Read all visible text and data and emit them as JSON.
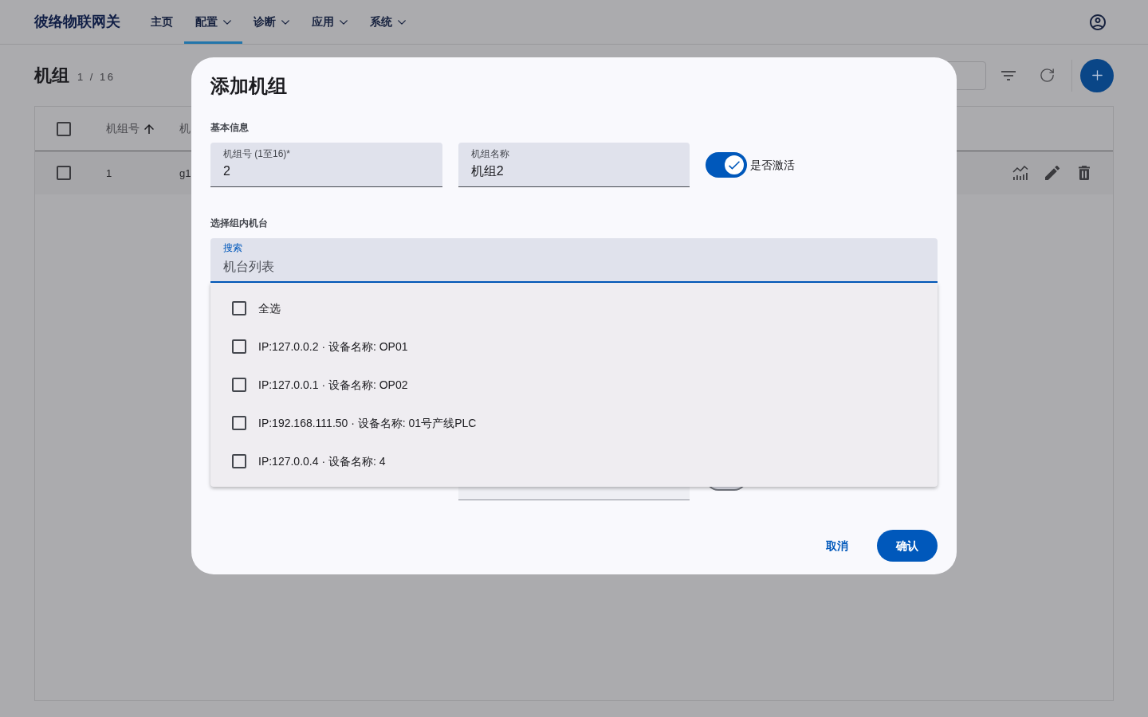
{
  "nav": {
    "brand": "彼络物联网关",
    "items": [
      {
        "label": "主页",
        "has_menu": false,
        "selected": false
      },
      {
        "label": "配置",
        "has_menu": true,
        "selected": true
      },
      {
        "label": "诊断",
        "has_menu": true,
        "selected": false
      },
      {
        "label": "应用",
        "has_menu": true,
        "selected": false
      },
      {
        "label": "系统",
        "has_menu": true,
        "selected": false
      }
    ]
  },
  "page": {
    "title": "机组",
    "count": "1 / 16"
  },
  "table": {
    "select_all": {
      "checked": false
    },
    "columns": [
      {
        "label": "机组号",
        "sorted": true
      },
      {
        "label": "机",
        "sorted": false
      }
    ],
    "rows": [
      {
        "checked": false,
        "cells": [
          "1",
          "g1"
        ]
      }
    ]
  },
  "dialog": {
    "title": "添加机组",
    "basic_section": {
      "heading": "基本信息",
      "fields": [
        {
          "label": "机组号 (1至16)*",
          "value": "2"
        },
        {
          "label": "机组名称",
          "value": "机组2"
        }
      ],
      "active_switch": {
        "label": "是否激活",
        "on": true
      }
    },
    "machines_section": {
      "heading": "选择组内机台",
      "search": {
        "label": "搜索",
        "placeholder": "机台列表",
        "focused": true
      },
      "options": [
        {
          "label": "全选",
          "checked": false
        },
        {
          "label": "IP:127.0.0.2 · 设备名称: OP01",
          "checked": false
        },
        {
          "label": "IP:127.0.0.1 · 设备名称: OP02",
          "checked": false
        },
        {
          "label": "IP:192.168.111.50 · 设备名称: 01号产线PLC",
          "checked": false
        },
        {
          "label": "IP:127.0.0.4 · 设备名称: 4",
          "checked": false
        }
      ]
    },
    "covered_switch": {
      "on": false
    },
    "buttons": [
      {
        "label": "取消",
        "kind": "text"
      },
      {
        "label": "确认",
        "kind": "filled"
      }
    ]
  }
}
